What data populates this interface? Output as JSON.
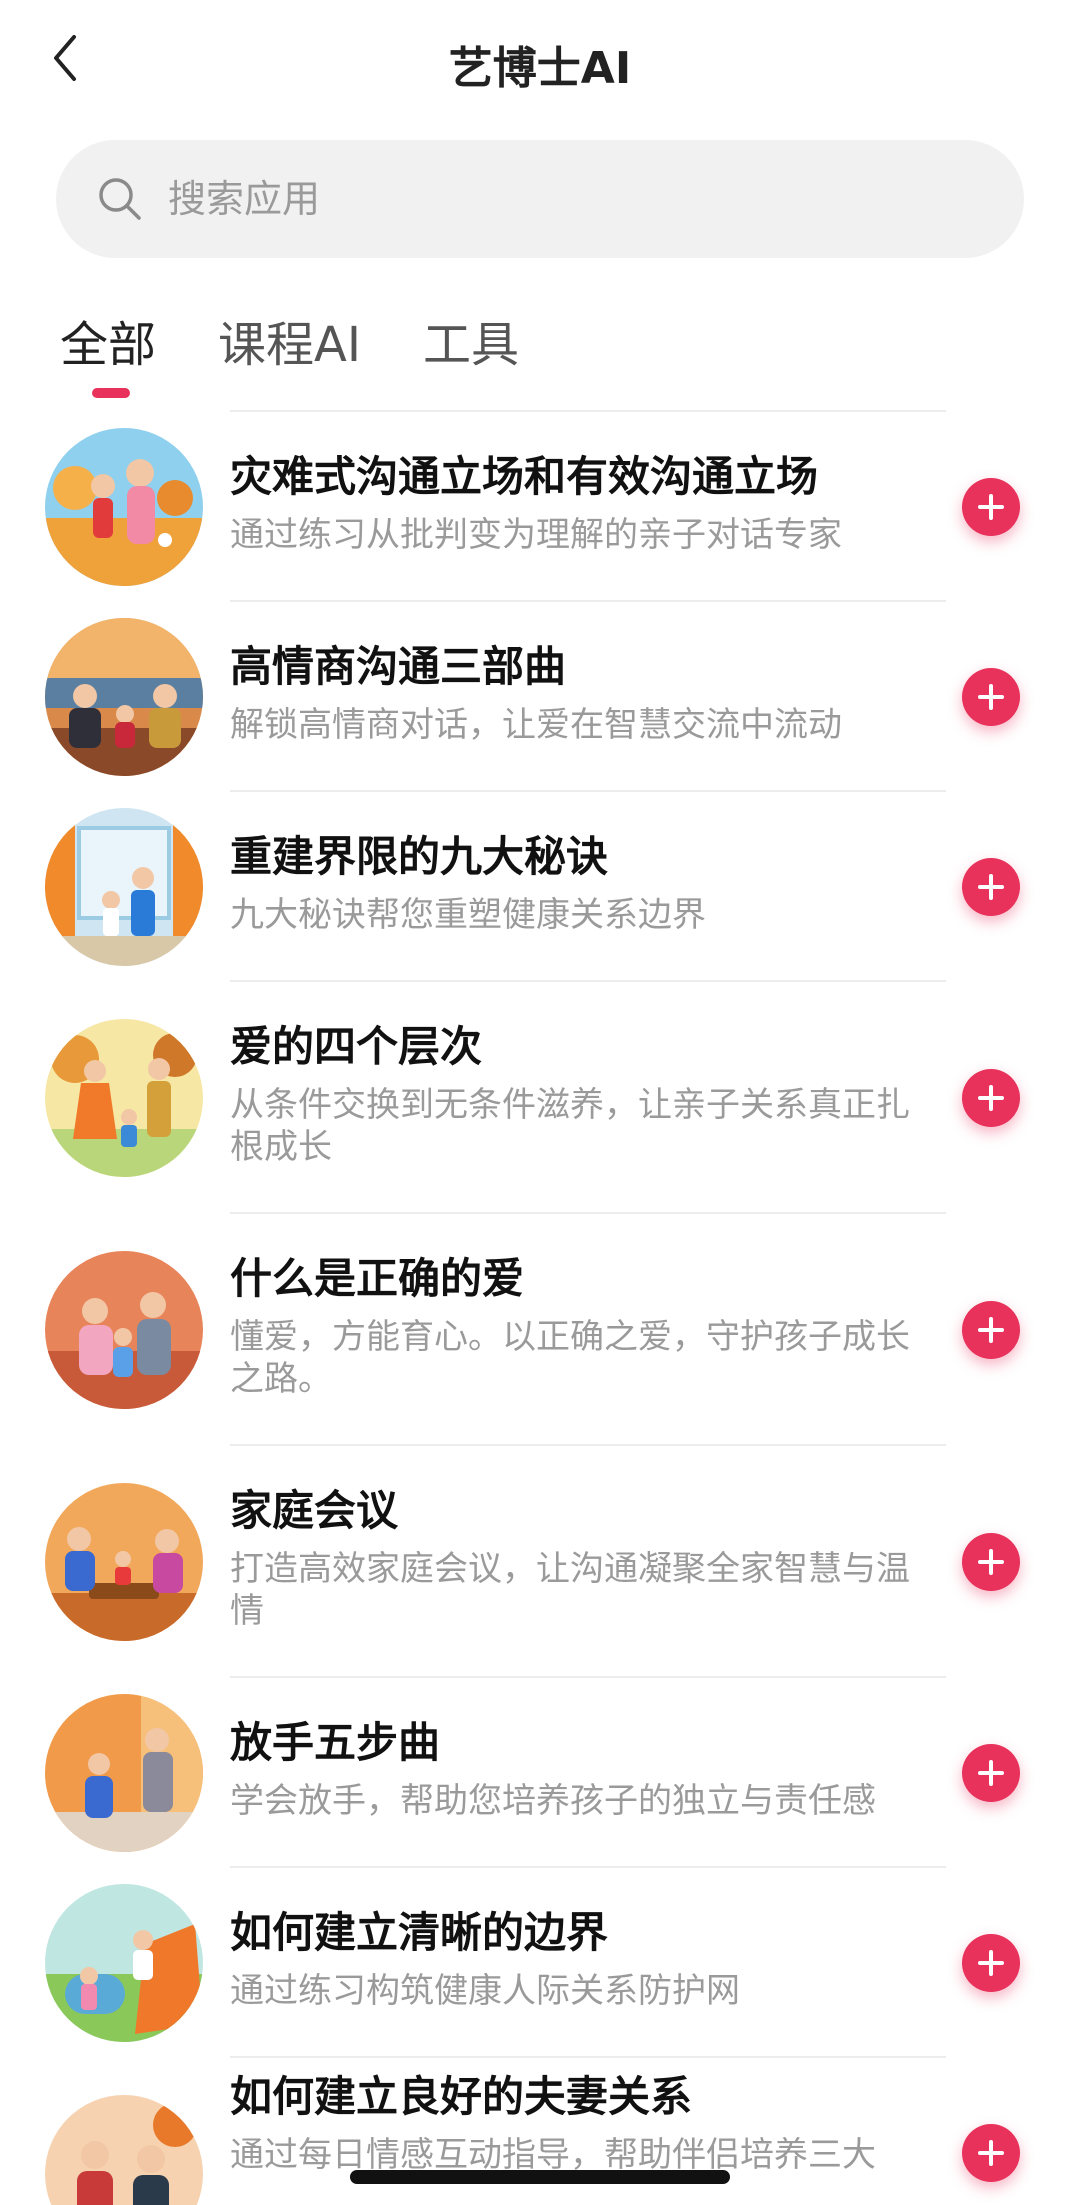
{
  "header": {
    "title": "艺博士AI",
    "back_icon": "chevron-left-icon"
  },
  "search": {
    "placeholder": "搜索应用",
    "icon": "search-icon"
  },
  "tabs": [
    {
      "label": "全部",
      "active": true
    },
    {
      "label": "课程AI",
      "active": false
    },
    {
      "label": "工具",
      "active": false
    }
  ],
  "colors": {
    "accent": "#e8315b",
    "title": "#111111",
    "subtitle": "#9a9a9a"
  },
  "items": [
    {
      "title": "灾难式沟通立场和有效沟通立场",
      "desc": "通过练习从批判变为理解的亲子对话专家"
    },
    {
      "title": "高情商沟通三部曲",
      "desc": "解锁高情商对话，让爱在智慧交流中流动"
    },
    {
      "title": "重建界限的九大秘诀",
      "desc": "九大秘诀帮您重塑健康关系边界"
    },
    {
      "title": "爱的四个层次",
      "desc": "从条件交换到无条件滋养，让亲子关系真正扎根成长"
    },
    {
      "title": "什么是正确的爱",
      "desc": "懂爱，方能育心。以正确之爱，守护孩子成长之路。"
    },
    {
      "title": "家庭会议",
      "desc": "打造高效家庭会议，让沟通凝聚全家智慧与温情"
    },
    {
      "title": "放手五步曲",
      "desc": "学会放手，帮助您培养孩子的独立与责任感"
    },
    {
      "title": "如何建立清晰的边界",
      "desc": "通过练习构筑健康人际关系防护网"
    },
    {
      "title": "如何建立良好的夫妻关系",
      "desc": "通过每日情感互动指导，帮助伴侣培养三大"
    }
  ]
}
